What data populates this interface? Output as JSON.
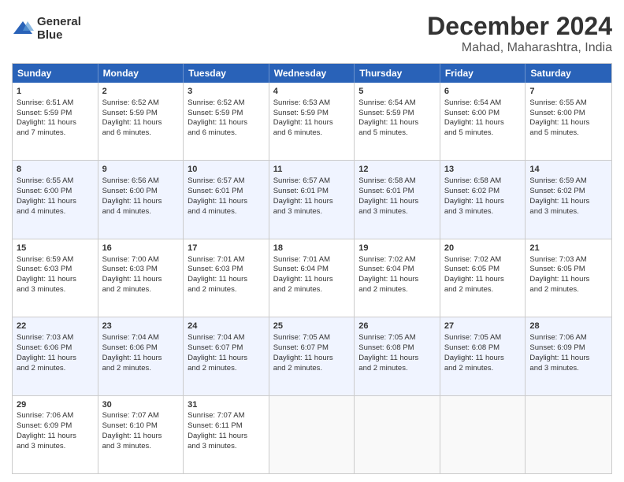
{
  "logo": {
    "line1": "General",
    "line2": "Blue"
  },
  "title": "December 2024",
  "subtitle": "Mahad, Maharashtra, India",
  "header_days": [
    "Sunday",
    "Monday",
    "Tuesday",
    "Wednesday",
    "Thursday",
    "Friday",
    "Saturday"
  ],
  "weeks": [
    [
      {
        "day": "1",
        "lines": [
          "Sunrise: 6:51 AM",
          "Sunset: 5:59 PM",
          "Daylight: 11 hours",
          "and 7 minutes."
        ]
      },
      {
        "day": "2",
        "lines": [
          "Sunrise: 6:52 AM",
          "Sunset: 5:59 PM",
          "Daylight: 11 hours",
          "and 6 minutes."
        ]
      },
      {
        "day": "3",
        "lines": [
          "Sunrise: 6:52 AM",
          "Sunset: 5:59 PM",
          "Daylight: 11 hours",
          "and 6 minutes."
        ]
      },
      {
        "day": "4",
        "lines": [
          "Sunrise: 6:53 AM",
          "Sunset: 5:59 PM",
          "Daylight: 11 hours",
          "and 6 minutes."
        ]
      },
      {
        "day": "5",
        "lines": [
          "Sunrise: 6:54 AM",
          "Sunset: 5:59 PM",
          "Daylight: 11 hours",
          "and 5 minutes."
        ]
      },
      {
        "day": "6",
        "lines": [
          "Sunrise: 6:54 AM",
          "Sunset: 6:00 PM",
          "Daylight: 11 hours",
          "and 5 minutes."
        ]
      },
      {
        "day": "7",
        "lines": [
          "Sunrise: 6:55 AM",
          "Sunset: 6:00 PM",
          "Daylight: 11 hours",
          "and 5 minutes."
        ]
      }
    ],
    [
      {
        "day": "8",
        "lines": [
          "Sunrise: 6:55 AM",
          "Sunset: 6:00 PM",
          "Daylight: 11 hours",
          "and 4 minutes."
        ]
      },
      {
        "day": "9",
        "lines": [
          "Sunrise: 6:56 AM",
          "Sunset: 6:00 PM",
          "Daylight: 11 hours",
          "and 4 minutes."
        ]
      },
      {
        "day": "10",
        "lines": [
          "Sunrise: 6:57 AM",
          "Sunset: 6:01 PM",
          "Daylight: 11 hours",
          "and 4 minutes."
        ]
      },
      {
        "day": "11",
        "lines": [
          "Sunrise: 6:57 AM",
          "Sunset: 6:01 PM",
          "Daylight: 11 hours",
          "and 3 minutes."
        ]
      },
      {
        "day": "12",
        "lines": [
          "Sunrise: 6:58 AM",
          "Sunset: 6:01 PM",
          "Daylight: 11 hours",
          "and 3 minutes."
        ]
      },
      {
        "day": "13",
        "lines": [
          "Sunrise: 6:58 AM",
          "Sunset: 6:02 PM",
          "Daylight: 11 hours",
          "and 3 minutes."
        ]
      },
      {
        "day": "14",
        "lines": [
          "Sunrise: 6:59 AM",
          "Sunset: 6:02 PM",
          "Daylight: 11 hours",
          "and 3 minutes."
        ]
      }
    ],
    [
      {
        "day": "15",
        "lines": [
          "Sunrise: 6:59 AM",
          "Sunset: 6:03 PM",
          "Daylight: 11 hours",
          "and 3 minutes."
        ]
      },
      {
        "day": "16",
        "lines": [
          "Sunrise: 7:00 AM",
          "Sunset: 6:03 PM",
          "Daylight: 11 hours",
          "and 2 minutes."
        ]
      },
      {
        "day": "17",
        "lines": [
          "Sunrise: 7:01 AM",
          "Sunset: 6:03 PM",
          "Daylight: 11 hours",
          "and 2 minutes."
        ]
      },
      {
        "day": "18",
        "lines": [
          "Sunrise: 7:01 AM",
          "Sunset: 6:04 PM",
          "Daylight: 11 hours",
          "and 2 minutes."
        ]
      },
      {
        "day": "19",
        "lines": [
          "Sunrise: 7:02 AM",
          "Sunset: 6:04 PM",
          "Daylight: 11 hours",
          "and 2 minutes."
        ]
      },
      {
        "day": "20",
        "lines": [
          "Sunrise: 7:02 AM",
          "Sunset: 6:05 PM",
          "Daylight: 11 hours",
          "and 2 minutes."
        ]
      },
      {
        "day": "21",
        "lines": [
          "Sunrise: 7:03 AM",
          "Sunset: 6:05 PM",
          "Daylight: 11 hours",
          "and 2 minutes."
        ]
      }
    ],
    [
      {
        "day": "22",
        "lines": [
          "Sunrise: 7:03 AM",
          "Sunset: 6:06 PM",
          "Daylight: 11 hours",
          "and 2 minutes."
        ]
      },
      {
        "day": "23",
        "lines": [
          "Sunrise: 7:04 AM",
          "Sunset: 6:06 PM",
          "Daylight: 11 hours",
          "and 2 minutes."
        ]
      },
      {
        "day": "24",
        "lines": [
          "Sunrise: 7:04 AM",
          "Sunset: 6:07 PM",
          "Daylight: 11 hours",
          "and 2 minutes."
        ]
      },
      {
        "day": "25",
        "lines": [
          "Sunrise: 7:05 AM",
          "Sunset: 6:07 PM",
          "Daylight: 11 hours",
          "and 2 minutes."
        ]
      },
      {
        "day": "26",
        "lines": [
          "Sunrise: 7:05 AM",
          "Sunset: 6:08 PM",
          "Daylight: 11 hours",
          "and 2 minutes."
        ]
      },
      {
        "day": "27",
        "lines": [
          "Sunrise: 7:05 AM",
          "Sunset: 6:08 PM",
          "Daylight: 11 hours",
          "and 2 minutes."
        ]
      },
      {
        "day": "28",
        "lines": [
          "Sunrise: 7:06 AM",
          "Sunset: 6:09 PM",
          "Daylight: 11 hours",
          "and 3 minutes."
        ]
      }
    ],
    [
      {
        "day": "29",
        "lines": [
          "Sunrise: 7:06 AM",
          "Sunset: 6:09 PM",
          "Daylight: 11 hours",
          "and 3 minutes."
        ]
      },
      {
        "day": "30",
        "lines": [
          "Sunrise: 7:07 AM",
          "Sunset: 6:10 PM",
          "Daylight: 11 hours",
          "and 3 minutes."
        ]
      },
      {
        "day": "31",
        "lines": [
          "Sunrise: 7:07 AM",
          "Sunset: 6:11 PM",
          "Daylight: 11 hours",
          "and 3 minutes."
        ]
      },
      {
        "day": "",
        "lines": []
      },
      {
        "day": "",
        "lines": []
      },
      {
        "day": "",
        "lines": []
      },
      {
        "day": "",
        "lines": []
      }
    ]
  ]
}
